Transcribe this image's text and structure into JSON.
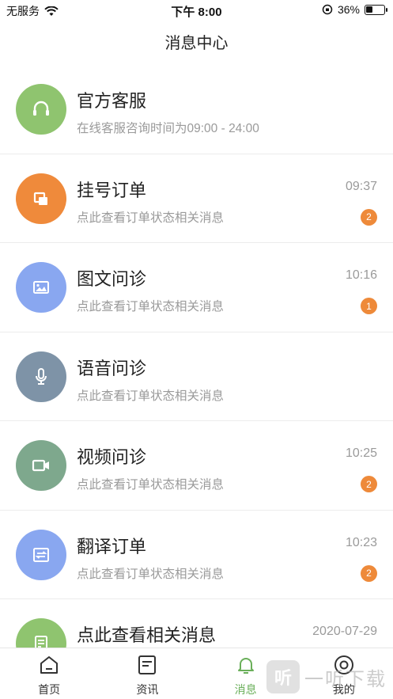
{
  "status_bar": {
    "carrier": "无服务",
    "time": "下午 8:00",
    "battery_percent": "36%",
    "battery_level": 0.36
  },
  "header": {
    "title": "消息中心"
  },
  "messages": [
    {
      "title": "官方客服",
      "subtitle": "在线客服咨询时间为09:00 - 24:00",
      "time": "",
      "badge": "",
      "color": "#8fc46f",
      "icon": "headset-icon"
    },
    {
      "title": "挂号订单",
      "subtitle": "点此查看订单状态相关消息",
      "time": "09:37",
      "badge": "2",
      "color": "#ef8a3b",
      "icon": "register-icon"
    },
    {
      "title": "图文问诊",
      "subtitle": "点此查看订单状态相关消息",
      "time": "10:16",
      "badge": "1",
      "color": "#89a7f0",
      "icon": "image-icon"
    },
    {
      "title": "语音问诊",
      "subtitle": "点此查看订单状态相关消息",
      "time": "",
      "badge": "",
      "color": "#7e93a7",
      "icon": "microphone-icon"
    },
    {
      "title": "视频问诊",
      "subtitle": "点此查看订单状态相关消息",
      "time": "10:25",
      "badge": "2",
      "color": "#7ea88d",
      "icon": "video-icon"
    },
    {
      "title": "翻译订单",
      "subtitle": "点此查看订单状态相关消息",
      "time": "10:23",
      "badge": "2",
      "color": "#89a7f0",
      "icon": "translate-icon"
    },
    {
      "title": "点此查看相关消息",
      "subtitle": "",
      "time": "2020-07-29",
      "badge": "",
      "color": "#8fc46f",
      "icon": "document-icon"
    }
  ],
  "tabs": [
    {
      "label": "首页",
      "icon": "home-icon",
      "active": false
    },
    {
      "label": "资讯",
      "icon": "news-icon",
      "active": false
    },
    {
      "label": "消息",
      "icon": "bell-icon",
      "active": true
    },
    {
      "label": "我的",
      "icon": "profile-icon",
      "active": false
    }
  ],
  "watermark": {
    "glyph": "听",
    "text": "一听下载"
  }
}
